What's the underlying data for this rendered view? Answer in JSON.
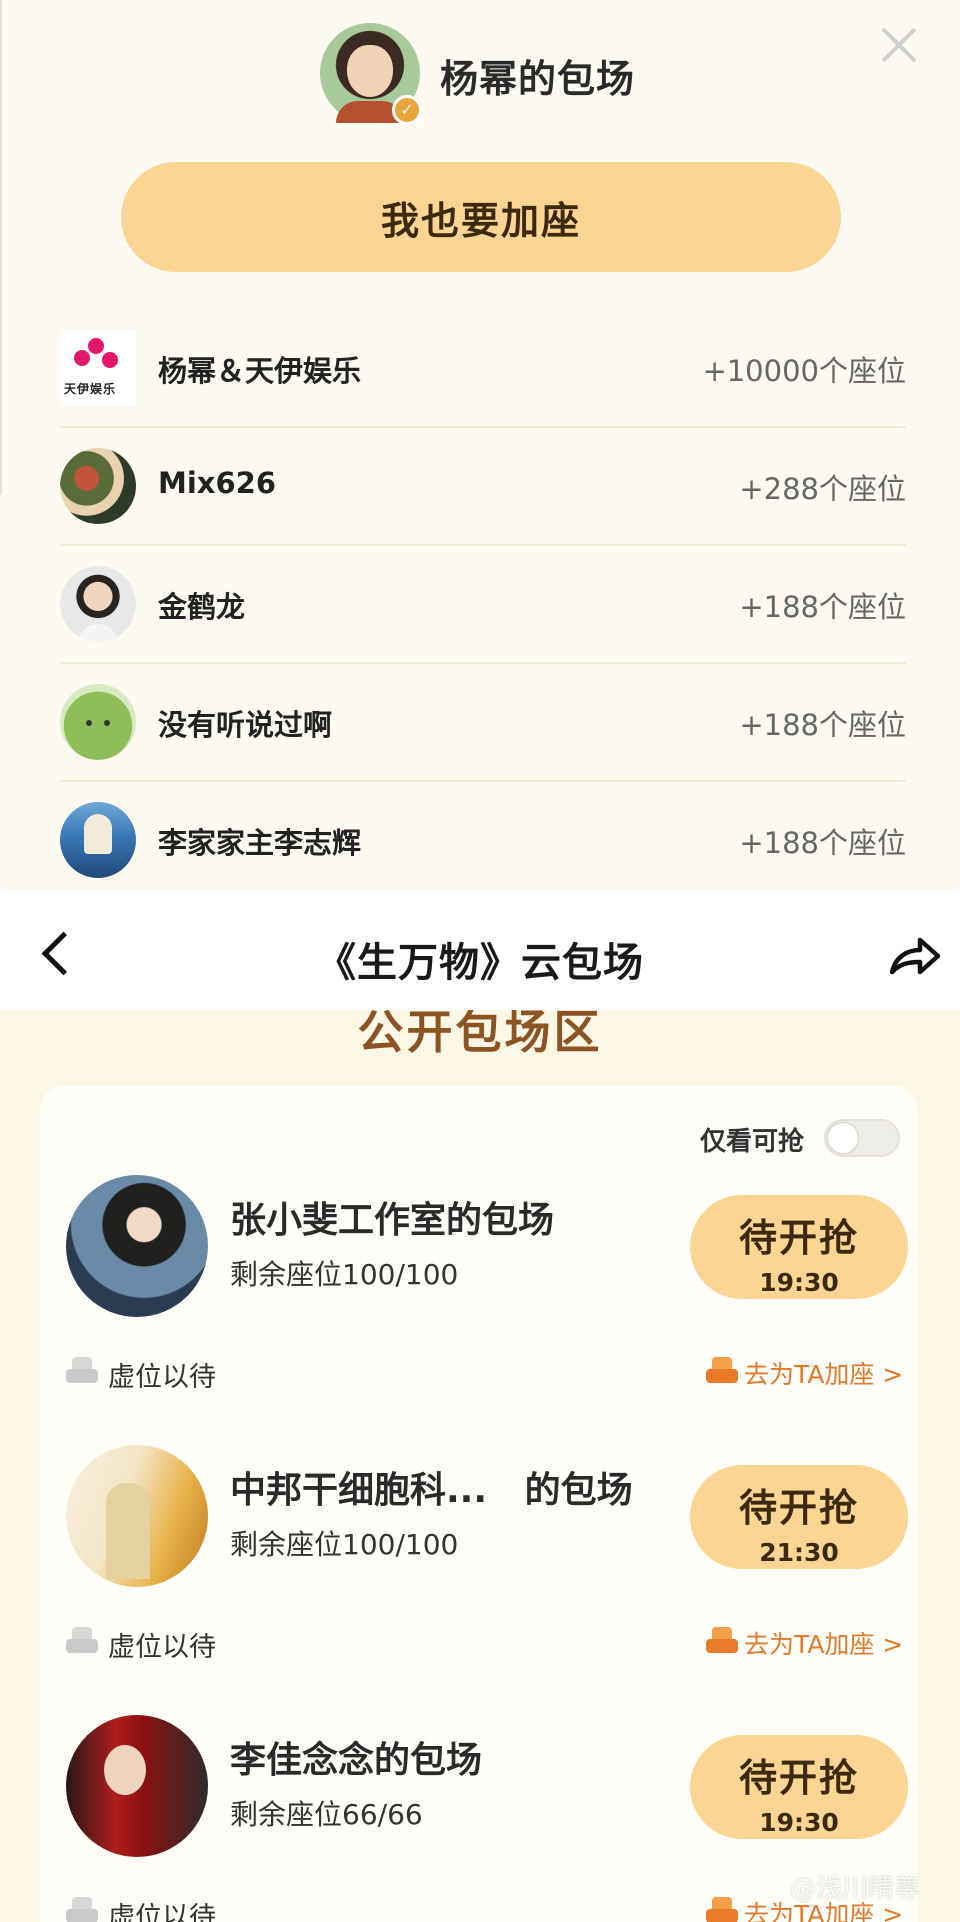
{
  "top_panel": {
    "title": "杨幂的包场",
    "verified_icon": "check-badge-icon",
    "join_button": "我也要加座",
    "contributors": [
      {
        "name": "杨幂＆天伊娱乐",
        "seats": "+10000个座位",
        "avatar": "tianyi-logo",
        "logo_text": "天伊娱乐"
      },
      {
        "name": "Mix626",
        "seats": "+288个座位",
        "avatar": "mix626-avatar"
      },
      {
        "name": "金鹤龙",
        "seats": "+188个座位",
        "avatar": "jinhelong-avatar"
      },
      {
        "name": "没有听说过啊",
        "seats": "+188个座位",
        "avatar": "melon-avatar"
      },
      {
        "name": "李家家主李志辉",
        "seats": "+188个座位",
        "avatar": "lizhihui-avatar"
      }
    ]
  },
  "nav": {
    "title": "《生万物》云包场",
    "back_icon": "chevron-left-icon",
    "share_icon": "share-arrow-icon"
  },
  "section": {
    "title": "公开包场区",
    "toggle_label": "仅看可抢",
    "toggle_on": false
  },
  "items": [
    {
      "title": "张小斐工作室的包场",
      "seats": "剩余座位100/100",
      "status": "待开抢",
      "time": "19:30",
      "wait": "虚位以待",
      "add_seat": "去为TA加座 >"
    },
    {
      "title": "中邦干细胞科...   的包场",
      "seats": "剩余座位100/100",
      "status": "待开抢",
      "time": "21:30",
      "wait": "虚位以待",
      "add_seat": "去为TA加座 >"
    },
    {
      "title": "李佳念念的包场",
      "seats": "剩余座位66/66",
      "status": "待开抢",
      "time": "19:30",
      "wait": "虚位以待",
      "add_seat": "去为TA加座 >"
    }
  ],
  "watermark": "@浅川晴尊",
  "colors": {
    "panel_bg": "#fdfbf1",
    "button_yellow": "#fad593",
    "section_bg": "#fdf7e6",
    "section_title": "#8c5425",
    "accent_orange": "#e4782a"
  }
}
